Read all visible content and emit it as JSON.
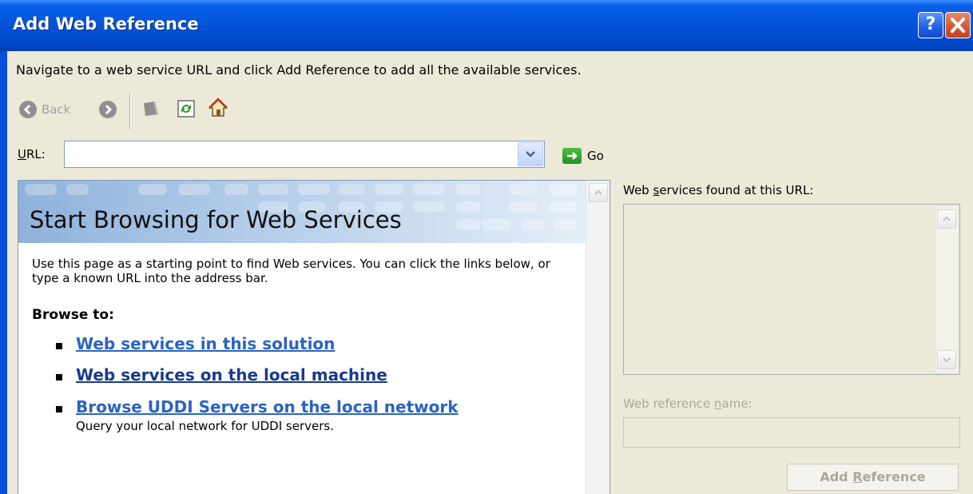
{
  "window": {
    "title": "Add Web Reference",
    "help_button": "?",
    "close_icon": "close-icon"
  },
  "instructions": "Navigate to a web service URL and click Add Reference to add all the available services.",
  "toolbar": {
    "back_label": "Back",
    "icons": [
      "back-arrow-icon",
      "forward-arrow-icon",
      "stop-icon",
      "refresh-icon",
      "home-icon"
    ]
  },
  "url_bar": {
    "label_mnemonic": "U",
    "label_rest": "RL:",
    "value": "",
    "go_label": "Go"
  },
  "browser": {
    "heading": "Start Browsing for Web Services",
    "intro": "Use this page as a starting point to find Web services. You can click the links below, or type a known URL into the address bar.",
    "browse_to": "Browse to:",
    "links": [
      {
        "label": "Web services in this solution",
        "description": ""
      },
      {
        "label": "Web services on the local machine",
        "description": ""
      },
      {
        "label": "Browse UDDI Servers on the local network",
        "description": "Query your local network for UDDI servers."
      }
    ]
  },
  "results_panel": {
    "found_label_pre": "Web ",
    "found_label_mnemonic": "s",
    "found_label_post": "ervices found at this URL:",
    "refname_label_pre": "Web reference ",
    "refname_label_mnemonic": "n",
    "refname_label_post": "ame:",
    "refname_value": "",
    "add_button_pre": "Add ",
    "add_button_mnemonic": "R",
    "add_button_post": "eference"
  },
  "colors": {
    "titlebar": "#0254D8",
    "dialog_bg": "#ECE9D8",
    "link": "#2A63C2",
    "link_visited": "#1A3A8C",
    "disabled_text": "#ACA899"
  }
}
